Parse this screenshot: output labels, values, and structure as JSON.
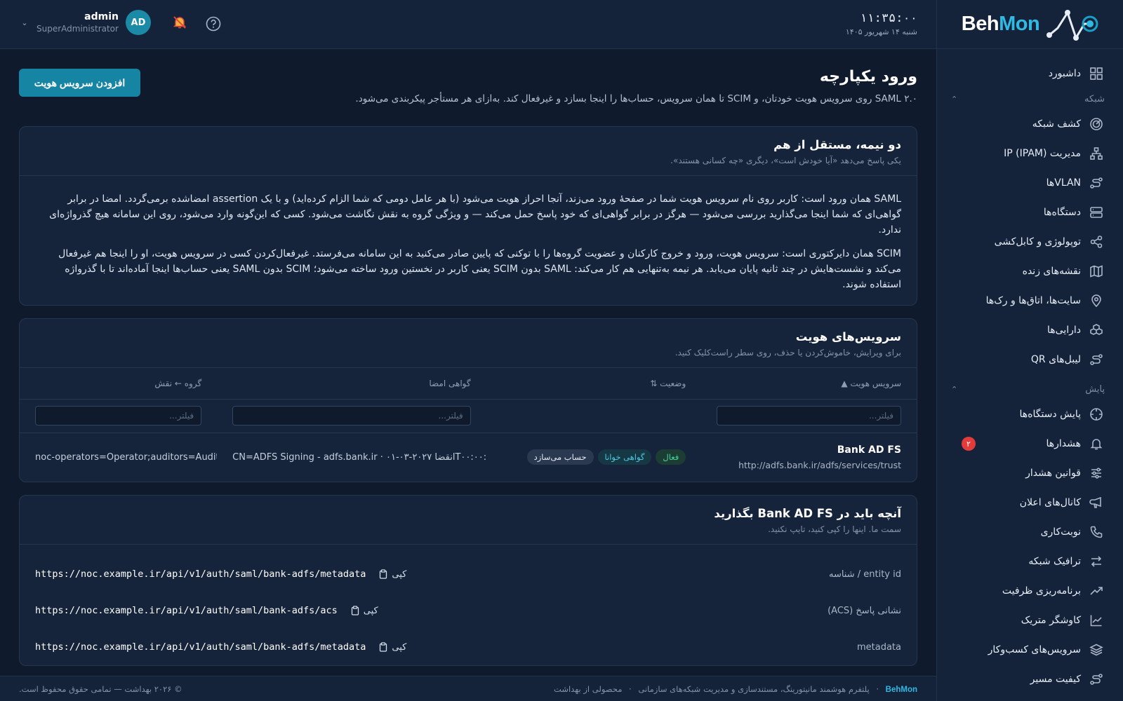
{
  "brand": {
    "name_a": "Beh",
    "name_b": "Mon"
  },
  "topbar": {
    "time": "۱۱:۳۵:۰۰",
    "date": "شنبه ۱۴ شهریور ۱۴۰۵",
    "user_name": "admin",
    "user_role": "SuperAdministrator",
    "avatar_initials": "AD"
  },
  "sidebar": {
    "items": [
      {
        "label": "داشبورد"
      },
      {
        "label": "کشف شبکه"
      },
      {
        "label": "مدیریت IP (IPAM)"
      },
      {
        "label": "VLANها"
      },
      {
        "label": "دستگاه‌ها"
      },
      {
        "label": "توپولوژی و کابل‌کشی"
      },
      {
        "label": "نقشه‌های زنده"
      },
      {
        "label": "سایت‌ها، اتاق‌ها و رک‌ها"
      },
      {
        "label": "دارایی‌ها"
      },
      {
        "label": "لیبل‌های QR"
      },
      {
        "label": "پایش دستگاه‌ها"
      },
      {
        "label": "هشدارها",
        "badge": "۲"
      },
      {
        "label": "قوانین هشدار"
      },
      {
        "label": "کانال‌های اعلان"
      },
      {
        "label": "نوبت‌کاری"
      },
      {
        "label": "ترافیک شبکه"
      },
      {
        "label": "برنامه‌ریزی ظرفیت"
      },
      {
        "label": "کاوشگر متریک"
      },
      {
        "label": "سرویس‌های کسب‌وکار"
      },
      {
        "label": "کیفیت مسیر"
      }
    ],
    "sections": {
      "network": "شبکه",
      "monitoring": "پایش"
    }
  },
  "page": {
    "title": "ورود یکپارچه",
    "subtitle": "SAML ۲.۰ روی سرویس هویت خودتان، و SCIM تا همان سرویس، حساب‌ها را اینجا بسازد و غیرفعال کند. به‌ازای هر مستأجر پیکربندی می‌شود.",
    "add_button": "افزودن سرویس هویت"
  },
  "intro_card": {
    "title": "دو نیمه، مستقل از هم",
    "subtitle": "یکی پاسخ می‌دهد «آیا خودش است»، دیگری «چه کسانی هستند».",
    "para1": "SAML همان ورود است: کاربر روی نام سرویس هویت شما در صفحهٔ ورود می‌زند، آنجا احراز هویت می‌شود (با هر عامل دومی که شما الزام کرده‌اید) و با یک assertion امضاشده برمی‌گردد. امضا در برابر گواهی‌ای که شما اینجا می‌گذارید بررسی می‌شود — هرگز در برابر گواهی‌ای که خود پاسخ حمل می‌کند — و ویژگی گروه به نقش نگاشت می‌شود. کسی که این‌گونه وارد می‌شود، روی این سامانه هیچ گذرواژه‌ای ندارد.",
    "para2": "SCIM همان دایرکتوری است: سرویس هویت، ورود و خروج کارکنان و عضویت گروه‌ها را با توکنی که پایین صادر می‌کنید به این سامانه می‌فرستد. غیرفعال‌کردن کسی در سرویس هویت، او را اینجا هم غیرفعال می‌کند و نشست‌هایش در چند ثانیه پایان می‌یابد. هر نیمه به‌تنهایی هم کار می‌کند: SAML بدون SCIM یعنی کاربر در نخستین ورود ساخته می‌شود؛ SCIM بدون SAML یعنی حساب‌ها اینجا آماده‌اند تا با گذرواژه استفاده شوند."
  },
  "services_card": {
    "title": "سرویس‌های هویت",
    "subtitle": "برای ویرایش، خاموش‌کردن یا حذف، روی سطر راست‌کلیک کنید.",
    "columns": [
      "سرویس هویت ▲",
      "وضعیت ⇅",
      "گواهی امضا",
      "گروه ← نقش"
    ],
    "filter_placeholder": "فیلتر...",
    "rows": [
      {
        "name": "Bank AD FS",
        "url": "http://adfs.bank.ir/adfs/services/trust",
        "pills": [
          "فعال",
          "گواهی خوانا",
          "حساب می‌سازد"
        ],
        "cert": "CN=ADFS Signing - adfs.bank.ir · انقضا ۲۰۲۷-۰۳-۰۱T۰۰:۰۰:۰۰Z",
        "groups": "noc-operators=Operator;auditors=Auditor"
      }
    ]
  },
  "config_card": {
    "title": "آنچه باید در Bank AD FS بگذارید",
    "subtitle": "سمت ما. اینها را کپی کنید، تایپ نکنید.",
    "copy_label": "کپی",
    "rows": [
      {
        "label": "entity id / شناسه",
        "value": "https://noc.example.ir/api/v1/auth/saml/bank-adfs/metadata"
      },
      {
        "label": "نشانی پاسخ (ACS)",
        "value": "https://noc.example.ir/api/v1/auth/saml/bank-adfs/acs"
      },
      {
        "label": "metadata",
        "value": "https://noc.example.ir/api/v1/auth/saml/bank-adfs/metadata"
      }
    ]
  },
  "footer": {
    "brand": "BehMon",
    "desc": "پلتفرم هوشمند مانیتورینگ، مستندسازی و مدیریت شبکه‌های سازمانی",
    "product": "محصولی از بهداشت",
    "copyright": "© ۲۰۲۶ بهداشت — تمامی حقوق محفوظ است."
  }
}
